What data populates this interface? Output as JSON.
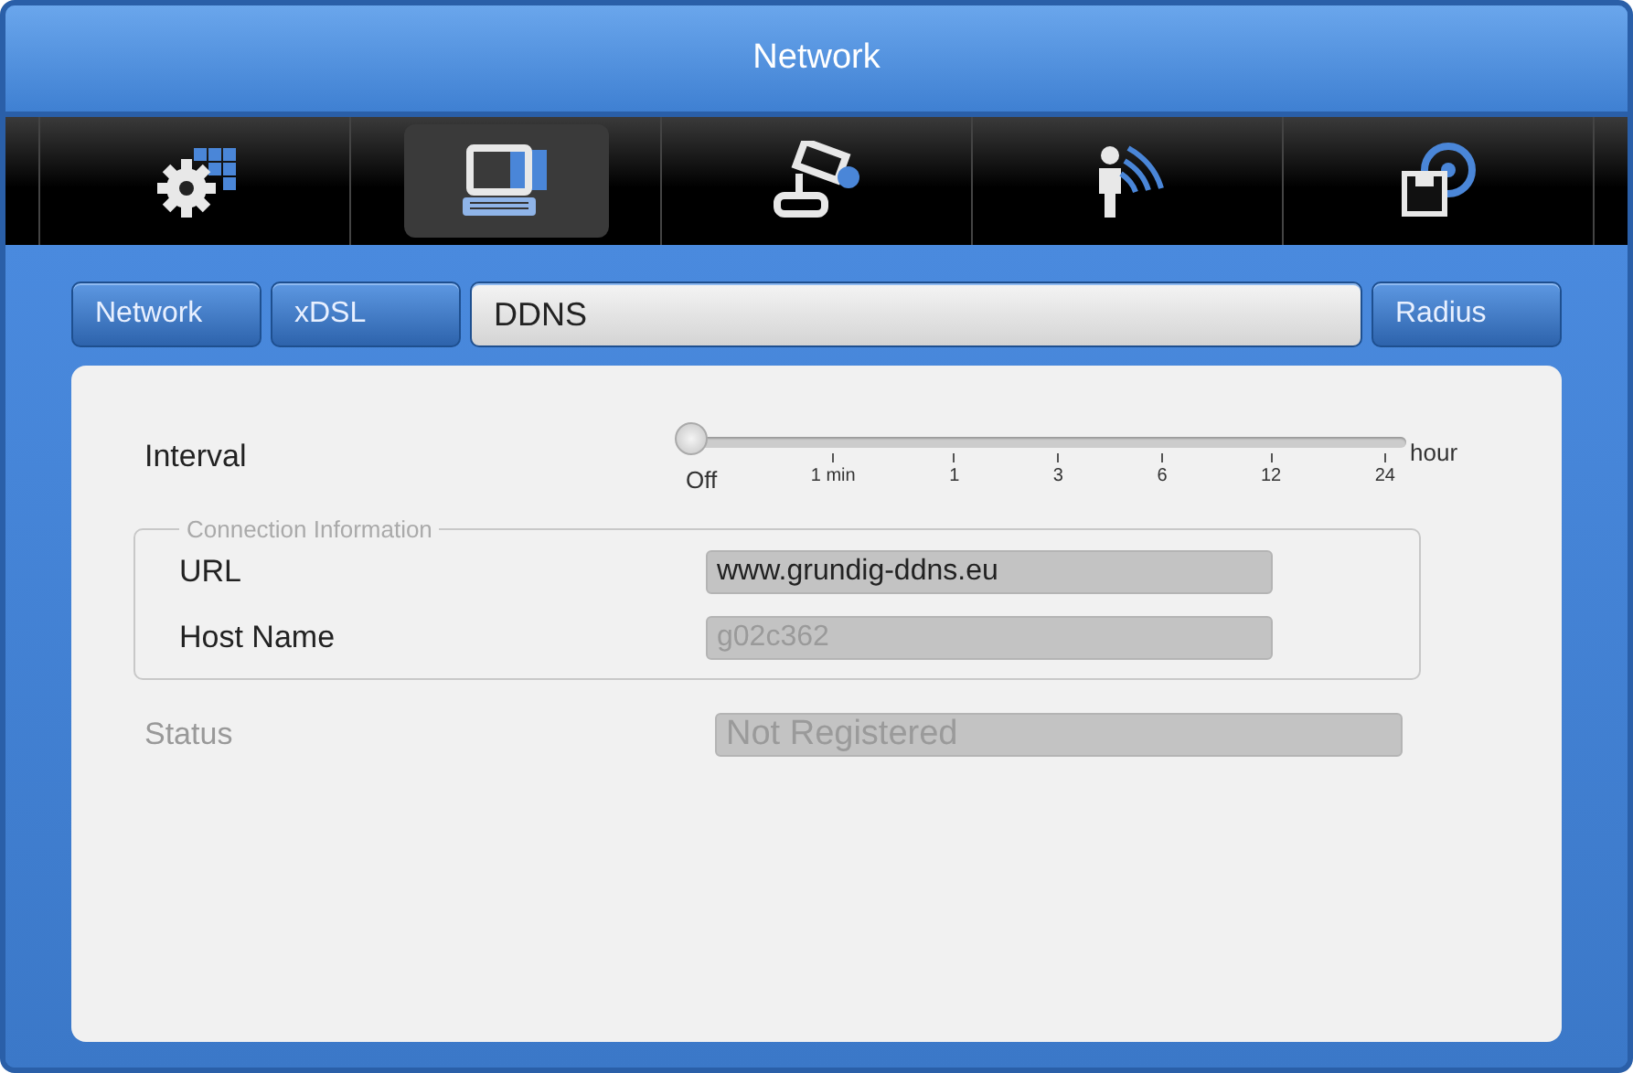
{
  "window": {
    "title": "Network"
  },
  "category_icons": [
    {
      "kind": "gear",
      "selected": false
    },
    {
      "kind": "computer",
      "selected": true
    },
    {
      "kind": "camera",
      "selected": false
    },
    {
      "kind": "person",
      "selected": false
    },
    {
      "kind": "disk",
      "selected": false
    }
  ],
  "tabs": [
    {
      "label": "Network",
      "selected": false
    },
    {
      "label": "xDSL",
      "selected": false
    },
    {
      "label": "DDNS",
      "selected": true
    },
    {
      "label": "Radius",
      "selected": false
    }
  ],
  "interval": {
    "label": "Interval",
    "level": 0,
    "ticks": [
      "Off",
      "1 min",
      "1",
      "3",
      "6",
      "12",
      "24"
    ],
    "unit": "hour"
  },
  "connection_information": {
    "title": "Connection Information",
    "fields": [
      {
        "label": "URL",
        "value": "www.grundig-ddns.eu",
        "disabled": false
      },
      {
        "label": "Host Name",
        "value": "g02c362",
        "disabled": true
      }
    ]
  },
  "status": {
    "label": "Status",
    "value": "Not Registered",
    "disabled": true
  }
}
